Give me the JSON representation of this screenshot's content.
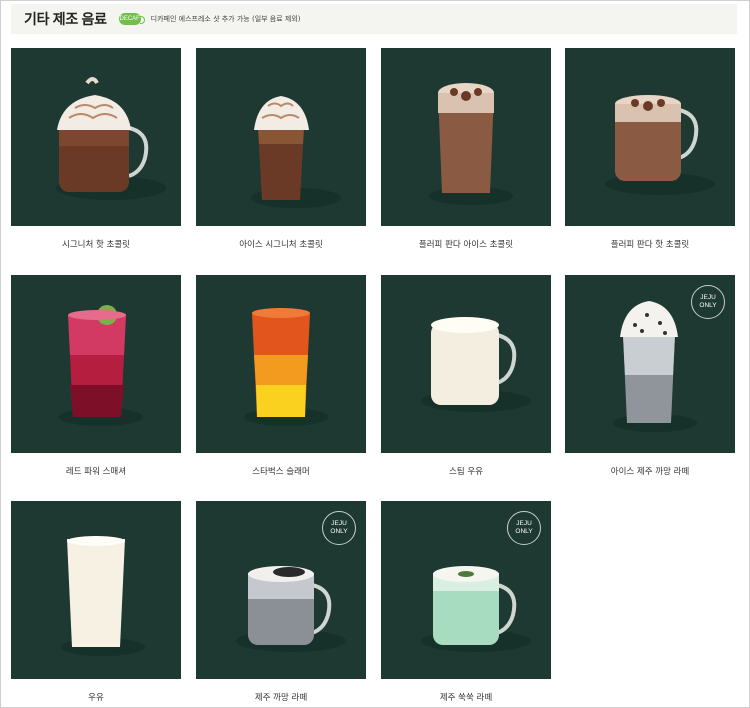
{
  "section": {
    "title": "기타 제조 음료",
    "decaf_badge": "DECAF",
    "decaf_note": "디카페인 에스프레소 샷 추가 가능 (일부 음료 제외)"
  },
  "products": [
    {
      "name": "시그니처 핫 초콜릿"
    },
    {
      "name": "아이스 시그니처 초콜릿"
    },
    {
      "name": "플러피 판다 아이스 초콜릿"
    },
    {
      "name": "플러피 판다 핫 초콜릿"
    },
    {
      "name": "레드 파워 스매셔"
    },
    {
      "name": "스타벅스 슬래머"
    },
    {
      "name": "스팀 우유"
    },
    {
      "name": "아이스 제주 까망 라떼",
      "badge": "JEJU ONLY"
    },
    {
      "name": "우유"
    },
    {
      "name": "제주 까망 라떼",
      "badge": "JEJU ONLY"
    },
    {
      "name": "제주 쑥쑥 라떼",
      "badge": "JEJU ONLY"
    }
  ],
  "colors": {
    "tile_bg": "#1e3932",
    "decaf_green": "#6fbf4a",
    "header_bg": "#f4f4f1"
  }
}
